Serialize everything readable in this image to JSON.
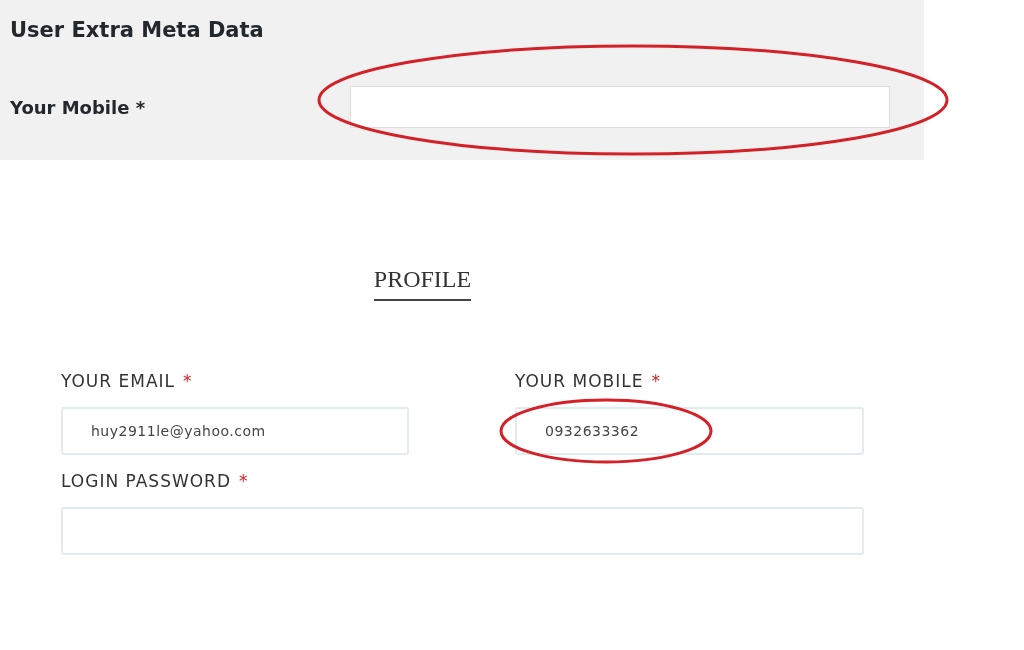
{
  "meta_panel": {
    "title": "User Extra Meta Data",
    "field": {
      "label": "Your Mobile *",
      "highlighted": true
    }
  },
  "profile": {
    "heading": "PROFILE",
    "fields": [
      {
        "label": "YOUR EMAIL",
        "required_mark": "*",
        "value": "huy2911le@yahoo.com",
        "highlighted": false
      },
      {
        "label": "YOUR MOBILE",
        "required_mark": "*",
        "value": "0932633362",
        "highlighted": true
      },
      {
        "label": "LOGIN PASSWORD",
        "required_mark": "*",
        "highlighted": false
      }
    ]
  }
}
